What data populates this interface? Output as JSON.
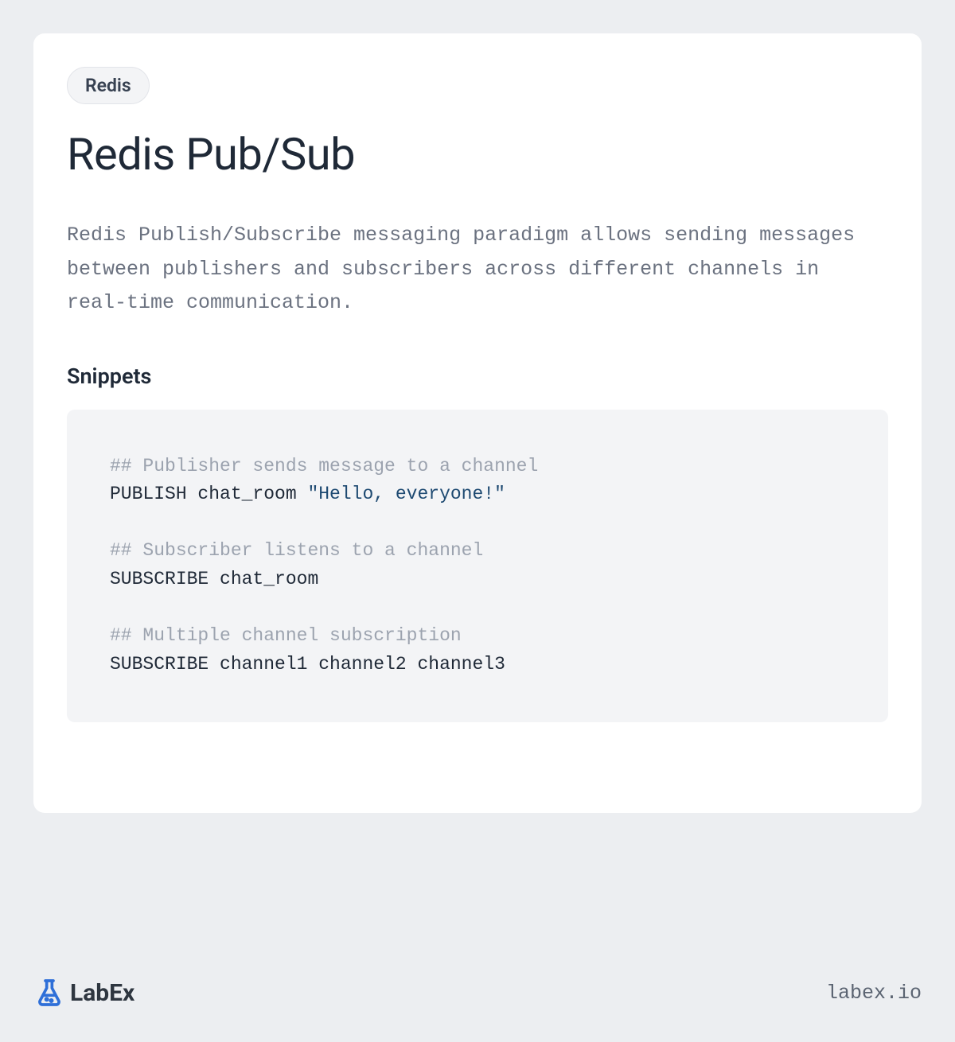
{
  "tag": "Redis",
  "title": "Redis Pub/Sub",
  "description": "Redis Publish/Subscribe messaging paradigm allows sending messages between publishers and subscribers across different channels in real-time communication.",
  "snippets_heading": "Snippets",
  "code": {
    "line1_comment": "## Publisher sends message to a channel",
    "line2_cmd": "PUBLISH chat_room ",
    "line2_str": "\"Hello, everyone!\"",
    "line3_comment": "## Subscriber listens to a channel",
    "line4_cmd": "SUBSCRIBE chat_room",
    "line5_comment": "## Multiple channel subscription",
    "line6_cmd": "SUBSCRIBE channel1 channel2 channel3"
  },
  "footer": {
    "brand": "LabEx",
    "url": "labex.io"
  }
}
